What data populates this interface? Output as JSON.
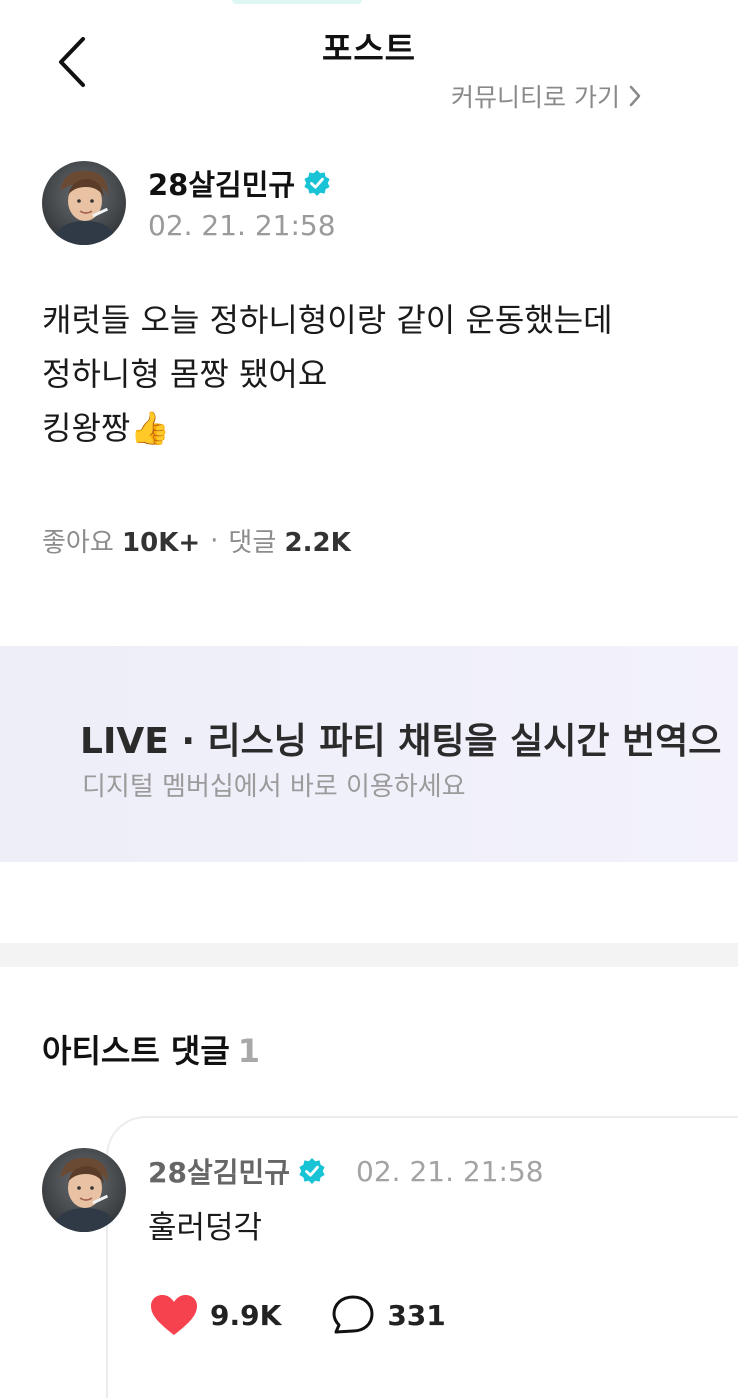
{
  "header": {
    "title": "포스트",
    "community_link": "커뮤니티로 가기"
  },
  "post": {
    "author": "28살김민규",
    "date": "02. 21. 21:58",
    "body": "캐럿들 오늘 정하니형이랑 같이 운동했는데\n정하니형 몸짱 됐어요\n킹왕짱👍",
    "likes_label": "좋아요",
    "likes_count": "10K+",
    "separator": "·",
    "comments_label": "댓글",
    "comments_count": "2.2K"
  },
  "banner": {
    "title": "LIVE · 리스닝 파티 채팅을 실시간 번역으",
    "subtitle": "디지털 멤버십에서 바로 이용하세요"
  },
  "artist_comments": {
    "title": "아티스트 댓글",
    "count": "1",
    "items": [
      {
        "author": "28살김민규",
        "date": "02. 21. 21:58",
        "text": "훌러덩각",
        "likes": "9.9K",
        "replies": "331"
      }
    ]
  },
  "colors": {
    "verified": "#19c3d6",
    "heart": "#f5424e",
    "banner_bg": "#eeeef8"
  },
  "icons": [
    "back-arrow-icon",
    "chevron-right-icon",
    "verified-badge-icon",
    "heart-icon",
    "comment-bubble-icon"
  ]
}
